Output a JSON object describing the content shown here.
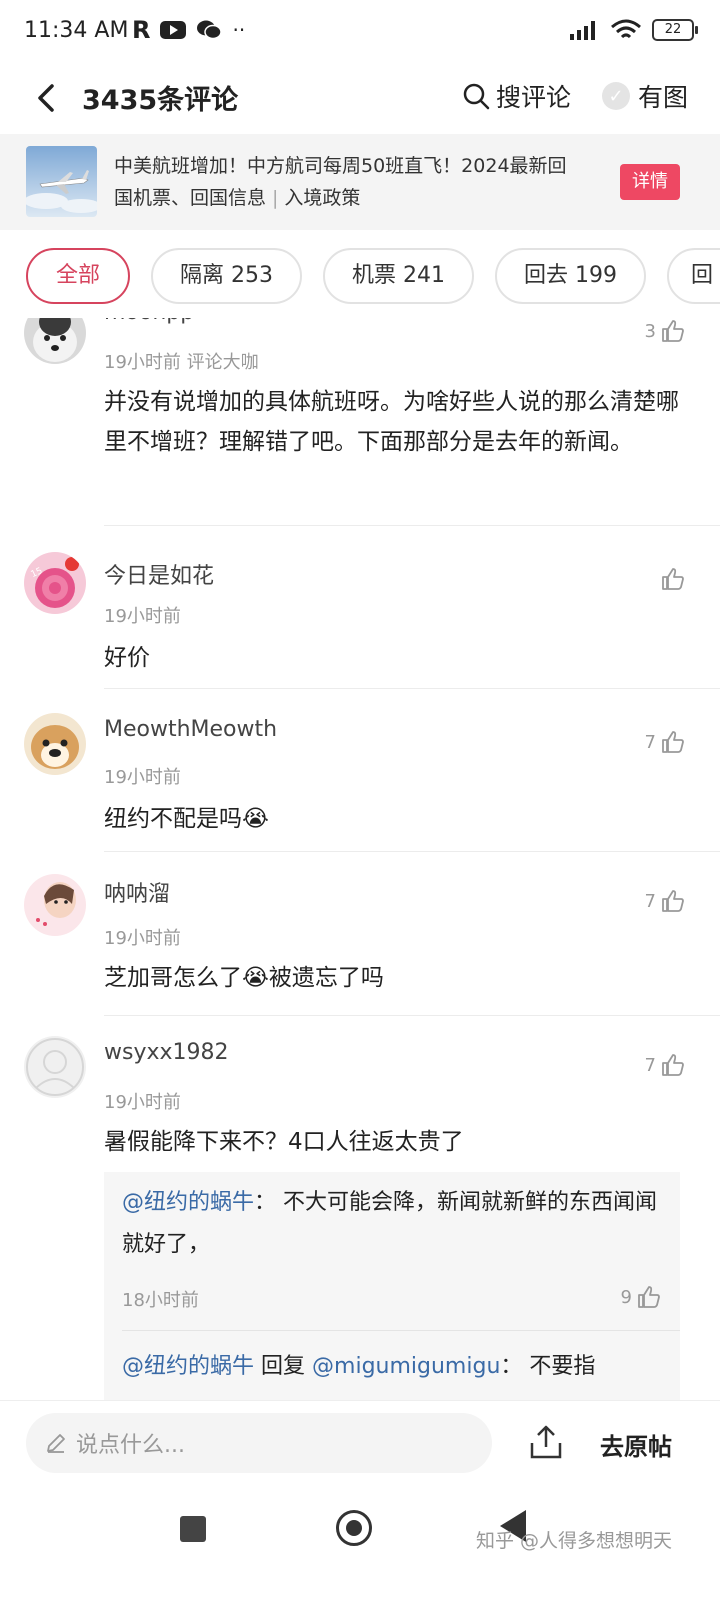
{
  "status_bar": {
    "time": "11:34 AM",
    "battery": "22",
    "network": "6"
  },
  "header": {
    "title": "3435条评论",
    "search_label": "搜评论",
    "image_toggle_label": "有图"
  },
  "banner": {
    "line1": "中美航班增加！中方航司每周50班直飞！2024最新回",
    "line2_a": "国机票、回国信息",
    "line2_sep": "|",
    "line2_b": "入境政策",
    "detail_button": "详情"
  },
  "tabs": [
    {
      "label": "全部",
      "active": true
    },
    {
      "label": "隔离 253"
    },
    {
      "label": "机票 241"
    },
    {
      "label": "回去 199"
    },
    {
      "label": "回"
    }
  ],
  "comments": [
    {
      "name": "moonpp",
      "meta": "19小时前  评论大咖",
      "likes": "3",
      "text": "并没有说增加的具体航班呀。为啥好些人说的那么清楚哪里不增班？理解错了吧。下面那部分是去年的新闻。"
    },
    {
      "name": "今日是如花",
      "meta": "19小时前",
      "likes": "",
      "text": "好价"
    },
    {
      "name": "MeowthMeowth",
      "meta": "19小时前",
      "likes": "7",
      "text": "纽约不配是吗😭"
    },
    {
      "name": "呐呐溜",
      "meta": "19小时前",
      "likes": "7",
      "text_a": "芝加哥怎么了",
      "emoji": "😭",
      "text_b": "被遗忘了吗"
    },
    {
      "name": "wsyxx1982",
      "meta": "19小时前",
      "likes": "7",
      "text": "暑假能降下来不？4口人往返太贵了",
      "replies": [
        {
          "author": "@纽约的蜗牛",
          "colon": "：",
          "text": "不大可能会降，新闻就新鲜的东西闻闻就好了，",
          "meta": "18小时前",
          "likes": "9"
        },
        {
          "author": "@纽约的蜗牛",
          "reply_word": "回复",
          "target": "@migumigumigu",
          "colon": "：",
          "text": "不要指"
        }
      ]
    }
  ],
  "bottom_bar": {
    "placeholder": "说点什么...",
    "goto_label": "去原帖"
  },
  "watermark": "知乎 @人得多想想明天",
  "colors": {
    "accent": "#d6445e",
    "detail_btn": "#ee4863",
    "mention": "#3a6aa6"
  }
}
